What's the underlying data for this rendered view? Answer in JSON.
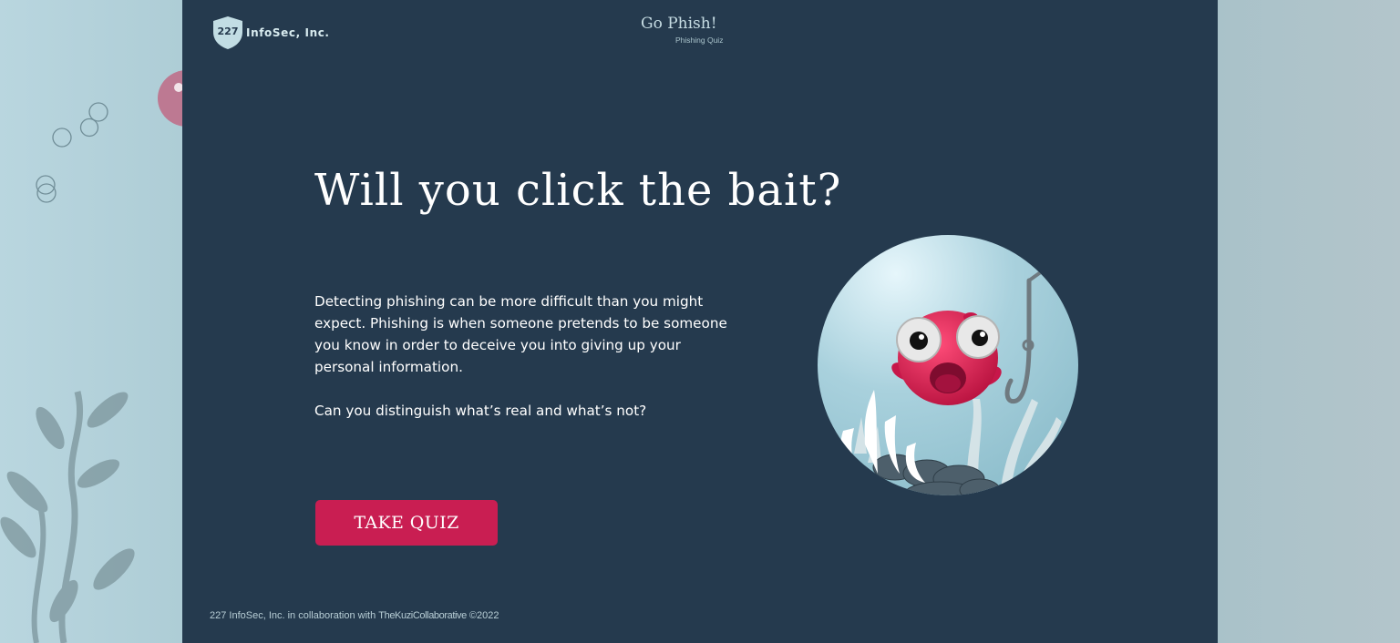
{
  "header": {
    "logo_number": "227",
    "logo_text": "InfoSec, Inc.",
    "brand_title": "Go Phish!",
    "brand_subtitle": "Phishing Quiz"
  },
  "hero": {
    "headline": "Will you click the bait?",
    "description": "Detecting phishing can be more difficult than you might expect. Phishing is when someone pretends to be someone you know in order to deceive you into giving up your personal information.",
    "question": "Can you distinguish what’s real and what’s not?",
    "cta_label": "TAKE QUIZ"
  },
  "footer": {
    "prefix": "227 InfoSec, Inc. in collaboration with",
    "collaborator": "TheKuziCollaborative",
    "copyright": "©2022"
  },
  "colors": {
    "panel": "#253a4e",
    "accent": "#c91e52",
    "water": "#b9d6df"
  },
  "icons": {
    "logo": "shield-icon",
    "illustration": "fish-hook-illustration"
  }
}
